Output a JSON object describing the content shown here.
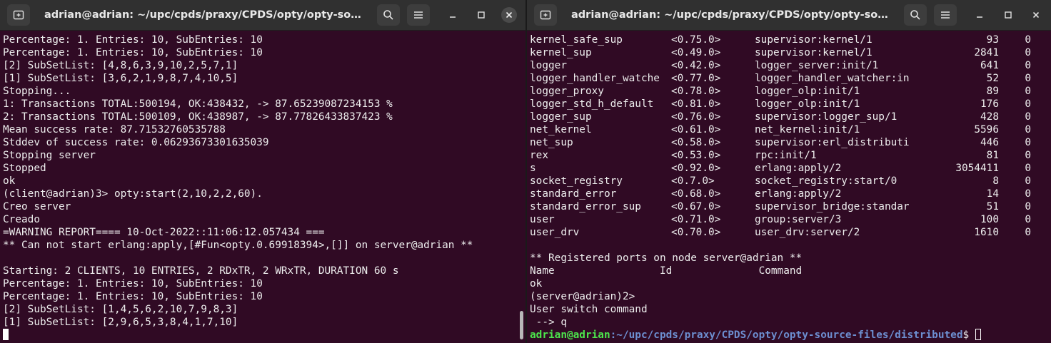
{
  "left_window": {
    "title": "adrian@adrian: ~/upc/cpds/praxy/CPDS/opty/opty-source-fil...",
    "lines": [
      "Percentage: 1. Entries: 10, SubEntries: 10",
      "Percentage: 1. Entries: 10, SubEntries: 10",
      "[2] SubSetList: [4,8,6,3,9,10,2,5,7,1]",
      "[1] SubSetList: [3,6,2,1,9,8,7,4,10,5]",
      "Stopping...",
      "1: Transactions TOTAL:500194, OK:438432, -> 87.65239087234153 %",
      "2: Transactions TOTAL:500109, OK:438987, -> 87.77826433837423 %",
      "Mean success rate: 87.71532760535788",
      "Stddev of success rate: 0.06293673301635039",
      "Stopping server",
      "Stopped",
      "ok",
      "(client@adrian)3> opty:start(2,10,2,2,60).",
      "Creo server",
      "Creado",
      "=WARNING REPORT==== 10-Oct-2022::11:06:12.057434 ===",
      "** Can not start erlang:apply,[#Fun<opty.0.69918394>,[]] on server@adrian **",
      "",
      "Starting: 2 CLIENTS, 10 ENTRIES, 2 RDxTR, 2 WRxTR, DURATION 60 s",
      "Percentage: 1. Entries: 10, SubEntries: 10",
      "Percentage: 1. Entries: 10, SubEntries: 10",
      "[2] SubSetList: [1,4,5,6,2,10,7,9,8,3]",
      "[1] SubSetList: [2,9,6,5,3,8,4,1,7,10]"
    ]
  },
  "right_window": {
    "title": "adrian@adrian: ~/upc/cpds/praxy/CPDS/opty/opty-source-fil...",
    "process_rows": [
      {
        "name": "kernel_safe_sup",
        "pid": "<0.75.0>",
        "init": "supervisor:kernel/1",
        "reds": "93",
        "msgs": "0"
      },
      {
        "name": "kernel_sup",
        "pid": "<0.49.0>",
        "init": "supervisor:kernel/1",
        "reds": "2841",
        "msgs": "0"
      },
      {
        "name": "logger",
        "pid": "<0.42.0>",
        "init": "logger_server:init/1",
        "reds": "641",
        "msgs": "0"
      },
      {
        "name": "logger_handler_watche",
        "pid": "<0.77.0>",
        "init": "logger_handler_watcher:in",
        "reds": "52",
        "msgs": "0"
      },
      {
        "name": "logger_proxy",
        "pid": "<0.78.0>",
        "init": "logger_olp:init/1",
        "reds": "89",
        "msgs": "0"
      },
      {
        "name": "logger_std_h_default",
        "pid": "<0.81.0>",
        "init": "logger_olp:init/1",
        "reds": "176",
        "msgs": "0"
      },
      {
        "name": "logger_sup",
        "pid": "<0.76.0>",
        "init": "supervisor:logger_sup/1",
        "reds": "428",
        "msgs": "0"
      },
      {
        "name": "net_kernel",
        "pid": "<0.61.0>",
        "init": "net_kernel:init/1",
        "reds": "5596",
        "msgs": "0"
      },
      {
        "name": "net_sup",
        "pid": "<0.58.0>",
        "init": "supervisor:erl_distributi",
        "reds": "446",
        "msgs": "0"
      },
      {
        "name": "rex",
        "pid": "<0.53.0>",
        "init": "rpc:init/1",
        "reds": "81",
        "msgs": "0"
      },
      {
        "name": "s",
        "pid": "<0.92.0>",
        "init": "erlang:apply/2",
        "reds": "3054411",
        "msgs": "0"
      },
      {
        "name": "socket_registry",
        "pid": "<0.7.0>",
        "init": "socket_registry:start/0",
        "reds": "8",
        "msgs": "0"
      },
      {
        "name": "standard_error",
        "pid": "<0.68.0>",
        "init": "erlang:apply/2",
        "reds": "14",
        "msgs": "0"
      },
      {
        "name": "standard_error_sup",
        "pid": "<0.67.0>",
        "init": "supervisor_bridge:standar",
        "reds": "51",
        "msgs": "0"
      },
      {
        "name": "user",
        "pid": "<0.71.0>",
        "init": "group:server/3",
        "reds": "100",
        "msgs": "0"
      },
      {
        "name": "user_drv",
        "pid": "<0.70.0>",
        "init": "user_drv:server/2",
        "reds": "1610",
        "msgs": "0"
      }
    ],
    "ports_header": "** Registered ports on node server@adrian **",
    "ports_columns": "Name                 Id              Command",
    "tail_lines": [
      "ok",
      "(server@adrian)2>",
      "User switch command",
      " --> q"
    ],
    "prompt_user": "adrian@adrian",
    "prompt_path": ":~/upc/cpds/praxy/CPDS/opty/opty-source-files/distributed",
    "prompt_symbol": "$ "
  },
  "icons": {
    "new_tab": "new-tab-icon",
    "search": "search-icon",
    "menu": "hamburger-menu-icon",
    "minimize": "minimize-icon",
    "maximize": "maximize-icon",
    "close": "close-icon"
  },
  "colors": {
    "terminal_bg": "#300a24",
    "titlebar_bg": "#303030",
    "prompt_user": "#4ce64c",
    "prompt_path": "#6d8fd1"
  }
}
